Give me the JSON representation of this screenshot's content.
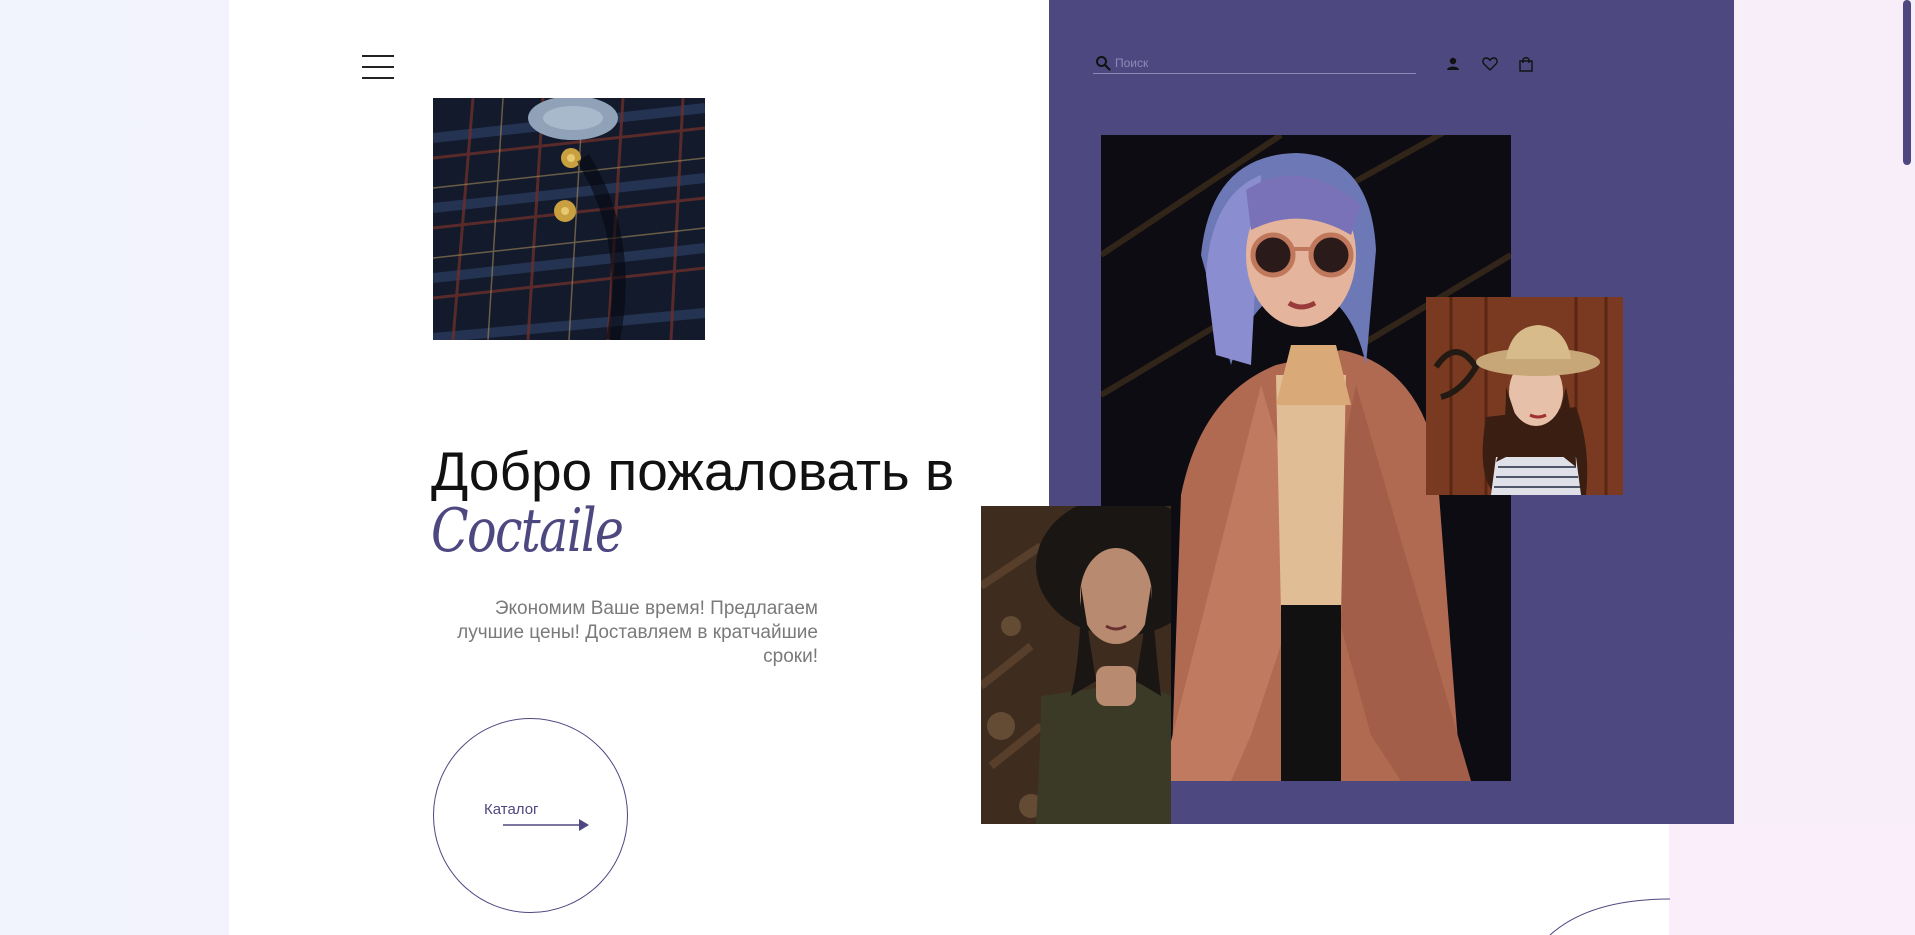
{
  "theme": {
    "accent": "#4e4880",
    "background": "#ffffff",
    "text_primary": "#111111",
    "text_muted": "#7a7a7a"
  },
  "header": {
    "menu_icon": "hamburger-menu-icon",
    "search": {
      "placeholder": "Поиск",
      "value": "",
      "icon": "search-icon"
    },
    "icons": [
      "user-icon",
      "heart-icon",
      "shopping-bag-icon"
    ]
  },
  "hero": {
    "title": "Добро пожаловать в",
    "brand": "Coctaile",
    "subtitle": "Экономим Ваше время! Предлагаем лучшие цены! Доставляем в кратчайшие сроки!",
    "catalog_button": {
      "label": "Каталог",
      "icon": "arrow-right-icon"
    }
  },
  "images": [
    "plaid-shirt-photo",
    "woman-in-coat-photo",
    "woman-in-straw-hat-photo",
    "woman-in-black-hat-photo"
  ]
}
